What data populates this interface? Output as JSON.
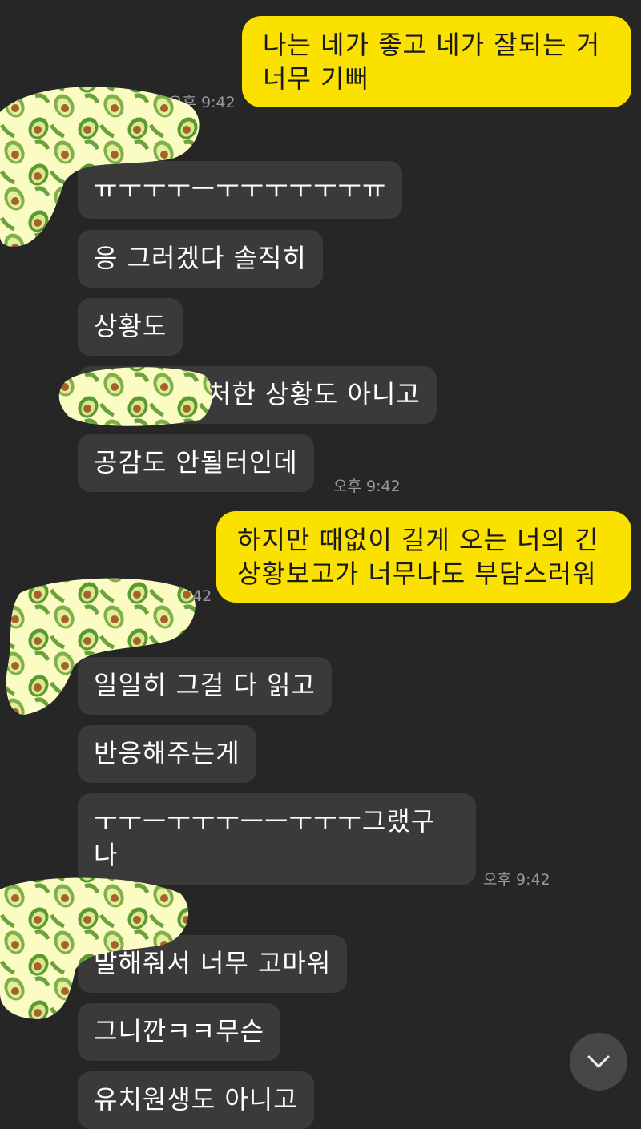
{
  "colors": {
    "background": "#262626",
    "my_bubble": "#fae100",
    "their_bubble": "#3a3a3a",
    "timestamp": "#9a9a9a"
  },
  "messages": [
    {
      "sender": "me",
      "text": "나는 네가 좋고 네가 잘되는 거\n너무 기뻐",
      "time": "오후 9:42"
    },
    {
      "sender": "other",
      "text": "ㅠㅜㅜㅜㅡㅜㅜㅜㅜㅜㅜㅠ"
    },
    {
      "sender": "other",
      "text": "응 그러겠다 솔직히"
    },
    {
      "sender": "other",
      "text": "상황도"
    },
    {
      "sender": "other",
      "text": "처한 상황도 아니고"
    },
    {
      "sender": "other",
      "text": "공감도 안될터인데",
      "time": "오후 9:42"
    },
    {
      "sender": "me",
      "text": "하지만 때없이 길게 오는 너의 긴\n상황보고가 너무나도 부담스러워",
      "time": "42"
    },
    {
      "sender": "other",
      "text": "일일히 그걸 다 읽고"
    },
    {
      "sender": "other",
      "text": "반응해주는게"
    },
    {
      "sender": "other",
      "text": "ㅜㅜㅡㅜㅜㅜㅡㅡㅜㅜㅜ그랬구\n나",
      "time": "오후 9:42"
    },
    {
      "sender": "other",
      "text": "말해줘서 너무 고마워"
    },
    {
      "sender": "other",
      "text": "그니깐ㅋㅋ무슨"
    },
    {
      "sender": "other",
      "text": "유치원생도 아니고"
    }
  ],
  "scroll_button": {
    "icon": "chevron-down-icon"
  }
}
